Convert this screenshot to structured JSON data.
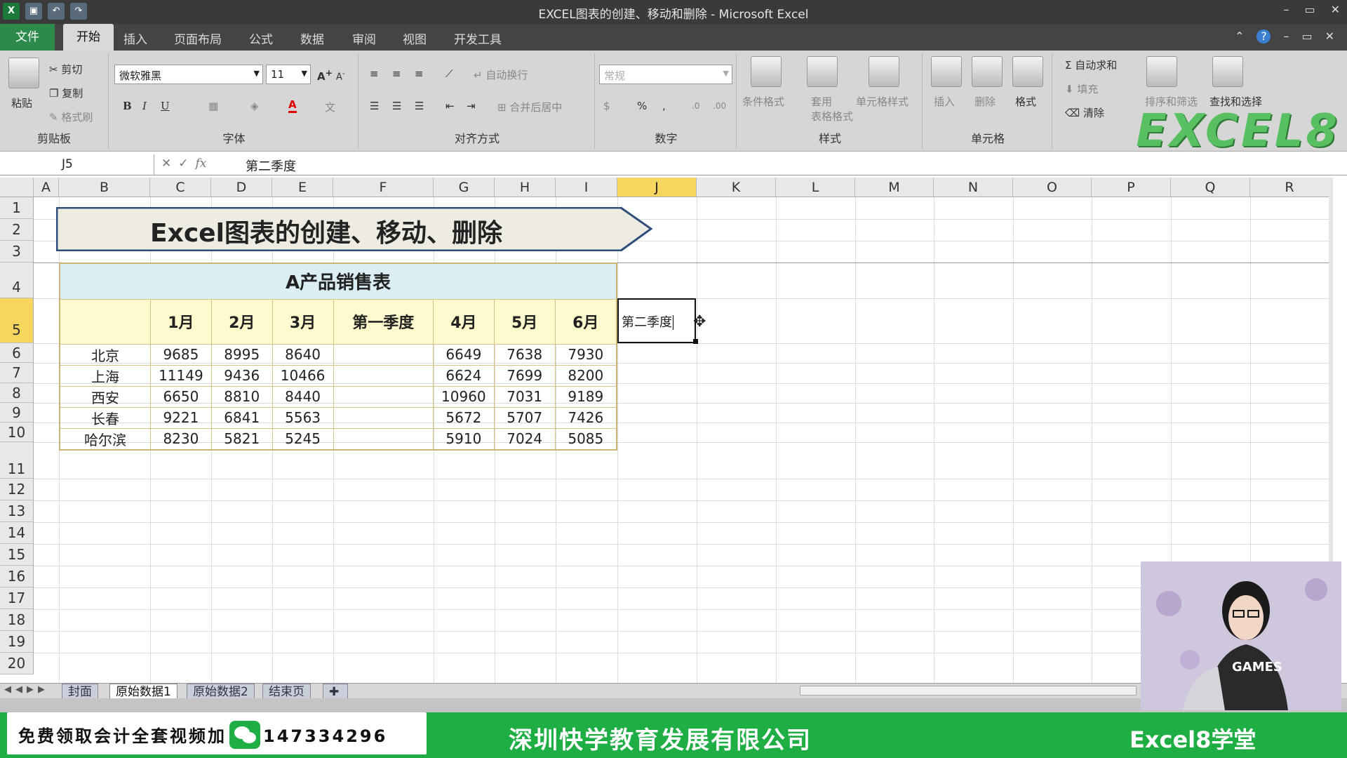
{
  "window": {
    "title": "EXCEL图表的创建、移动和删除 - Microsoft Excel",
    "controls": [
      "–",
      "▭",
      "✕"
    ]
  },
  "menu": {
    "file": "文件",
    "tabs": [
      "开始",
      "插入",
      "页面布局",
      "公式",
      "数据",
      "审阅",
      "视图",
      "开发工具"
    ]
  },
  "ribbon": {
    "clipboard": {
      "paste": "粘贴",
      "cut": "剪切",
      "copy": "复制",
      "format_painter": "格式刷",
      "label": "剪贴板"
    },
    "font": {
      "name": "微软雅黑",
      "size": "11",
      "label": "字体"
    },
    "alignment": {
      "wrap": "自动换行",
      "merge": "合并后居中",
      "label": "对齐方式"
    },
    "number": {
      "format": "常规",
      "label": "数字"
    },
    "styles": {
      "conditional": "条件格式",
      "table_line1": "套用",
      "table_line2": "表格格式",
      "cell_styles": "单元格样式",
      "label": "样式"
    },
    "cells": {
      "insert": "插入",
      "delete": "删除",
      "format": "格式",
      "label": "单元格"
    },
    "editing": {
      "autosum": "自动求和",
      "fill": "填充",
      "clear": "清除",
      "sort": "排序和筛选",
      "find": "查找和选择"
    },
    "watermark": "EXCEL8"
  },
  "formula_bar": {
    "cell_ref": "J5",
    "content": "第二季度"
  },
  "grid": {
    "columns": [
      "A",
      "B",
      "C",
      "D",
      "E",
      "F",
      "G",
      "H",
      "I",
      "J",
      "K",
      "L",
      "M",
      "N",
      "O",
      "P",
      "Q",
      "R"
    ],
    "rows": [
      "1",
      "2",
      "3",
      "4",
      "5",
      "6",
      "7",
      "8",
      "9",
      "10",
      "11",
      "12",
      "13",
      "14",
      "15",
      "16",
      "17",
      "18",
      "19",
      "20"
    ],
    "selected_column": "J",
    "selected_row": "5"
  },
  "banner": {
    "title": "Excel图表的创建、移动、删除"
  },
  "sales_table": {
    "title": "A产品销售表",
    "headers": [
      "",
      "1月",
      "2月",
      "3月",
      "第一季度",
      "4月",
      "5月",
      "6月"
    ],
    "rows": [
      [
        "北京",
        "9685",
        "8995",
        "8640",
        "",
        "6649",
        "7638",
        "7930"
      ],
      [
        "上海",
        "11149",
        "9436",
        "10466",
        "",
        "6624",
        "7699",
        "8200"
      ],
      [
        "西安",
        "6650",
        "8810",
        "8440",
        "",
        "10960",
        "7031",
        "9189"
      ],
      [
        "长春",
        "9221",
        "6841",
        "5563",
        "",
        "5672",
        "5707",
        "7426"
      ],
      [
        "哈尔滨",
        "8230",
        "5821",
        "5245",
        "",
        "5910",
        "7024",
        "5085"
      ]
    ]
  },
  "active_cell_value": "第二季度",
  "sheet_tabs": [
    "封面",
    "原始数据1",
    "原始数据2",
    "结束页"
  ],
  "active_sheet": "原始数据1",
  "promo": {
    "left_text": "免费领取会计全套视频加",
    "phone": "147334296",
    "company": "深圳快学教育发展有限公司",
    "brand": "Excel8学堂"
  },
  "webcam": {
    "shirt_text": "GAMES"
  },
  "colors": {
    "selected_header": "#f6d65e",
    "table_header_bg": "#daeef3",
    "table_month_bg": "#fffacd",
    "promo_green": "#1fae44"
  }
}
